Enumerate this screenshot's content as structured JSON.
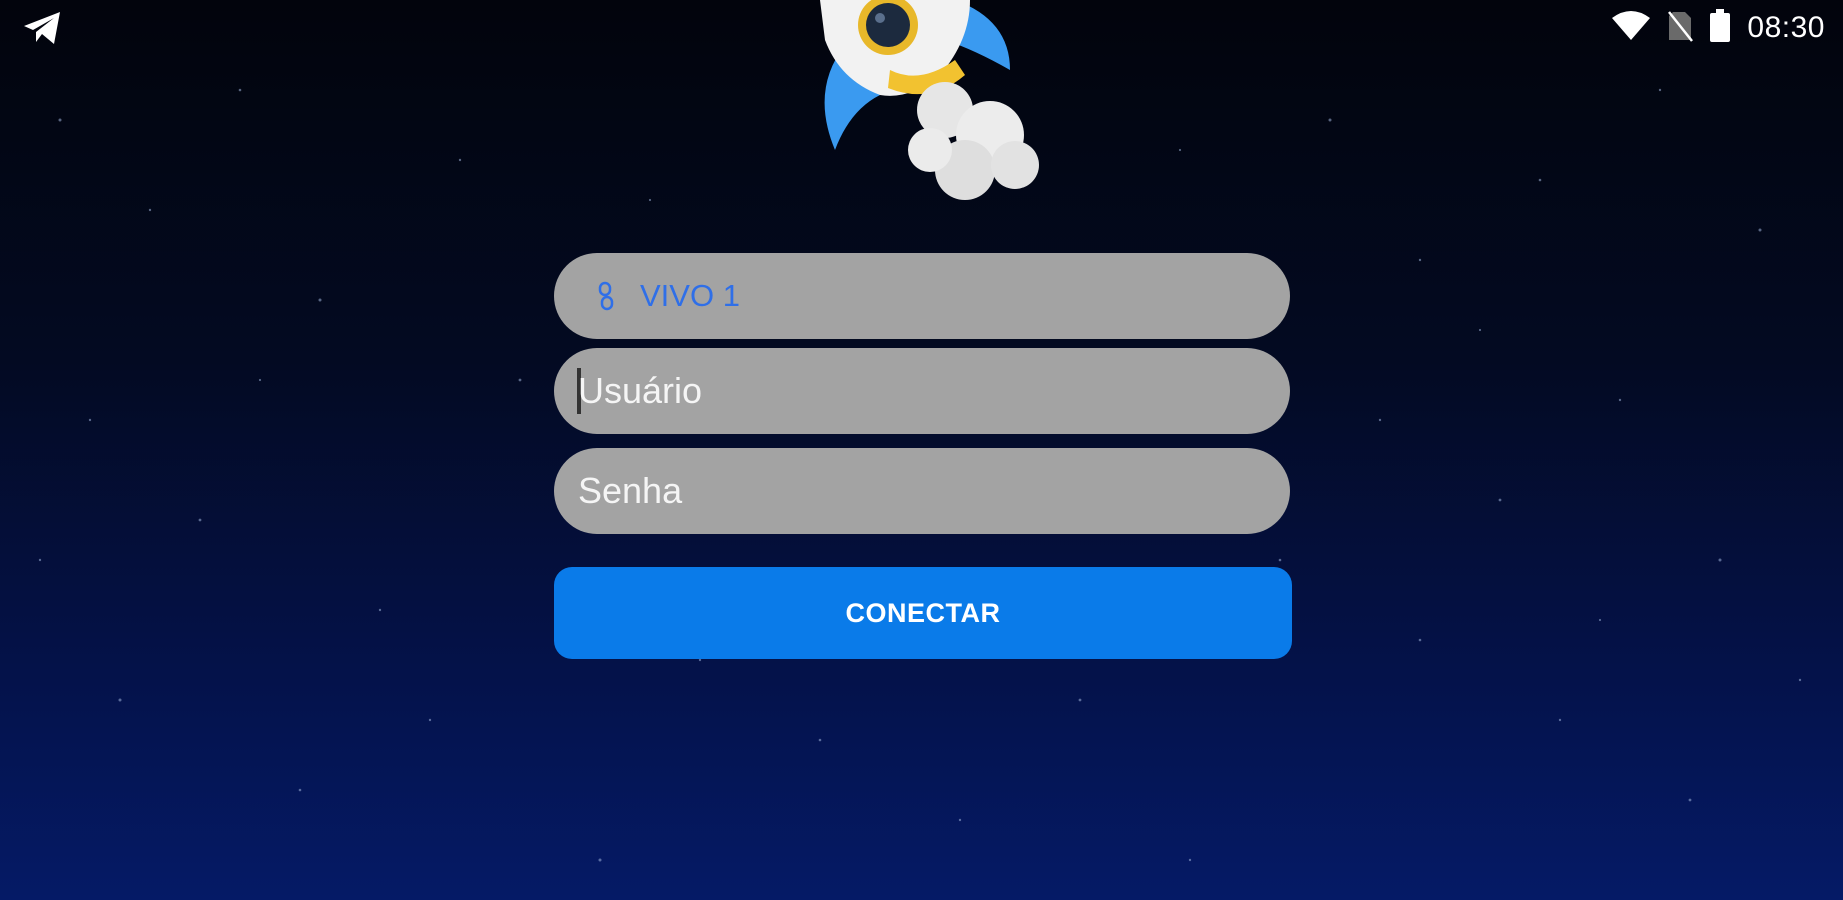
{
  "status_bar": {
    "left_icon": "telegram-icon",
    "icons": [
      "wifi-icon",
      "no-sim-icon",
      "battery-icon"
    ],
    "time": "08:30"
  },
  "hero": {
    "image": "rocket-illustration"
  },
  "login": {
    "server": {
      "icon": "link-icon",
      "label": "VIVO 1"
    },
    "username": {
      "placeholder": "Usuário",
      "value": ""
    },
    "password": {
      "placeholder": "Senha",
      "value": ""
    },
    "connect_label": "CONECTAR"
  },
  "colors": {
    "accent": "#0a7be9",
    "field_bg": "#a3a3a3",
    "server_text": "#2f6fe8",
    "background_top": "#02040c",
    "background_bottom": "#051a66"
  }
}
